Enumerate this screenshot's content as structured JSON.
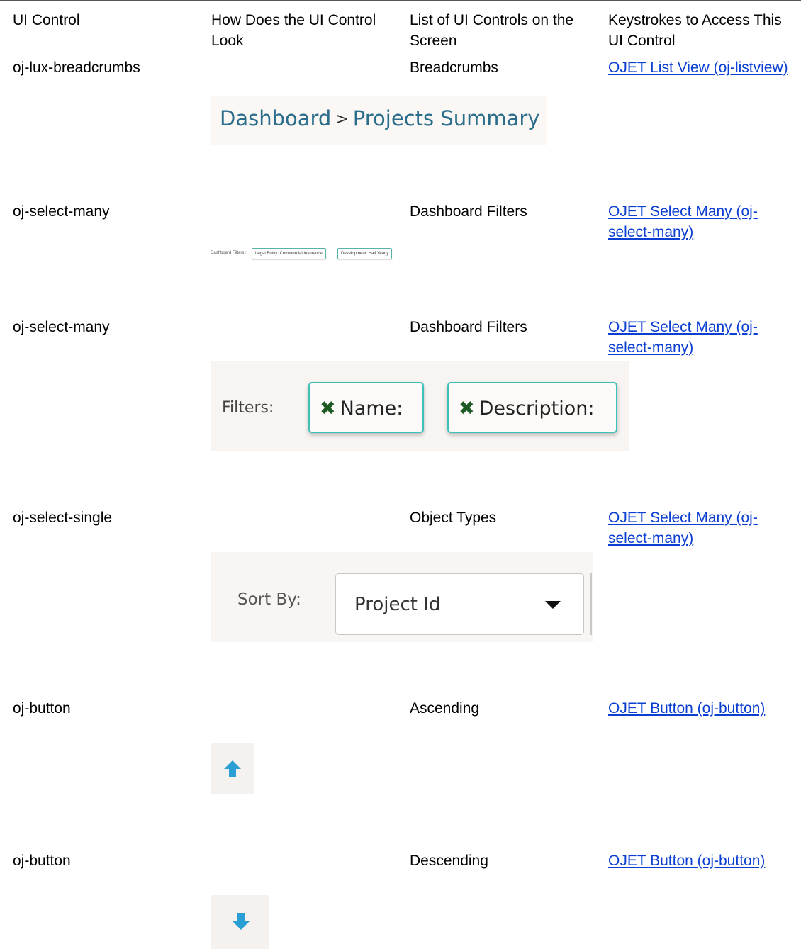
{
  "table": {
    "headers": [
      "UI Control",
      "How Does the UI Control Look",
      "List of UI Controls on the Screen",
      "Keystrokes to Access This UI Control"
    ],
    "rows": [
      {
        "control": "oj-lux-breadcrumbs",
        "screen_control": "Breadcrumbs",
        "link": "OJET List View (oj-listview)"
      },
      {
        "control": "oj-select-many",
        "screen_control": "Dashboard Filters",
        "link": "OJET Select Many (oj-select-many)"
      },
      {
        "control": "oj-select-many",
        "screen_control": "Dashboard Filters",
        "link": "OJET Select Many (oj-select-many)"
      },
      {
        "control": "oj-select-single",
        "screen_control": "Object Types",
        "link": "OJET Select Many (oj-select-many)"
      },
      {
        "control": "oj-button",
        "screen_control": "Ascending",
        "link": "OJET Button (oj-button)"
      },
      {
        "control": "oj-button",
        "screen_control": "Descending",
        "link": "OJET Button (oj-button)"
      }
    ]
  },
  "previews": {
    "breadcrumbs": {
      "first": "Dashboard",
      "separator": ">",
      "second": "Projects Summary"
    },
    "dashboard_filters": {
      "label": "Dashboard Filters :",
      "chips": [
        "Legal Entity: Commercial Insurance",
        "Development: Half Yearly"
      ]
    },
    "filters": {
      "label": "Filters:",
      "chips": [
        "Name:",
        "Description:"
      ],
      "remove_glyph": "✖"
    },
    "sort_by": {
      "label": "Sort By:",
      "value": "Project Id"
    },
    "arrow_up": "up-arrow-icon",
    "arrow_down": "down-arrow-icon"
  },
  "colors": {
    "link": "#0b3fd1",
    "breadcrumb": "#2a6e8c",
    "chip_border": "#3fbfb8",
    "arrow": "#2a9fd6"
  }
}
